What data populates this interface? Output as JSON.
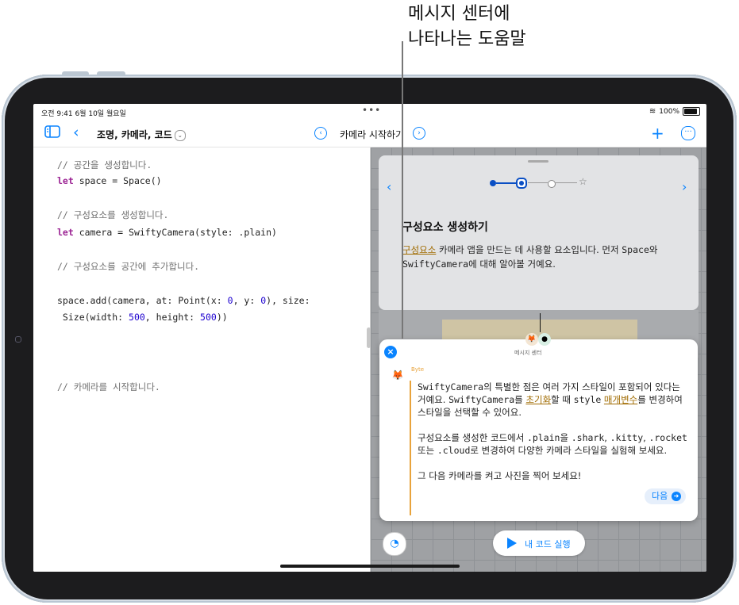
{
  "callout": {
    "line1": "메시지 센터에",
    "line2": "나타나는 도움말"
  },
  "status": {
    "time": "오전 9:41  6월 10일 월요일",
    "battery": "100%"
  },
  "toolbar": {
    "title": "조명, 카메라, 코드",
    "page_title": "카메라 시작하기",
    "icons": [
      "sidebar-icon",
      "back-chevron-icon",
      "prev-page-icon",
      "next-page-icon",
      "plus-icon",
      "more-icon"
    ]
  },
  "code": {
    "c1": "// 공간을 생성합니다.",
    "l1_kw": "let",
    "l1_rest": " space = Space()",
    "c2": "// 구성요소를 생성합니다.",
    "l2_kw": "let",
    "l2_rest": " camera = SwiftyCamera(style: .plain)",
    "c3": "// 구성요소를 공간에 추가합니다.",
    "l3_a": "space.add(camera, at: Point(x: ",
    "l3_n1": "0",
    "l3_b": ", y: ",
    "l3_n2": "0",
    "l3_c": "), size:",
    "l4_a": " Size(width: ",
    "l4_n1": "500",
    "l4_b": ", height: ",
    "l4_n2": "500",
    "l4_c": "))",
    "c4": "// 카메라를 시작합니다."
  },
  "guide": {
    "title": "구성요소 생성하기",
    "link": "구성요소",
    "body_a": " 카메라 앱을 만드는 데 사용할 요소입니다. 먼저 ",
    "mono1": "Space",
    "body_b": "와 ",
    "mono2": "SwiftyCamera",
    "body_c": "에 대해 알아볼 거예요.",
    "current_step": 2,
    "total_steps": 4
  },
  "message": {
    "label": "메시지 센터",
    "sender": "Byte",
    "p1_m1": "SwiftyCamera",
    "p1_a": "의 특별한 점은 여러 가지 스타일이 포함되어 있다는 거예요. ",
    "p1_m2": "SwiftyCamera",
    "p1_b": "를 ",
    "p1_link1": "초기화",
    "p1_c": "할 때 ",
    "p1_m3": "style",
    "p1_d": " ",
    "p1_link2": "매개변수",
    "p1_e": "를 변경하여 스타일을 선택할 수 있어요.",
    "p2_a": "구성요소를 생성한 코드에서 ",
    "p2_m1": ".plain",
    "p2_b": "을 ",
    "p2_m2": ".shark",
    "p2_c": ", ",
    "p2_m3": ".kitty",
    "p2_d": ", ",
    "p2_m4": ".rocket",
    "p2_e": " 또는 ",
    "p2_m5": ".cloud",
    "p2_f": "로 변경하여 다양한 카메라 스타일을 실험해 보세요.",
    "p3": "그 다음 카메라를 켜고 사진을 찍어 보세요!",
    "next": "다음"
  },
  "run_button": "내 코드 실행",
  "colors": {
    "accent": "#0a84ff",
    "link": "#a06b00",
    "byte": "#e8a33c"
  }
}
